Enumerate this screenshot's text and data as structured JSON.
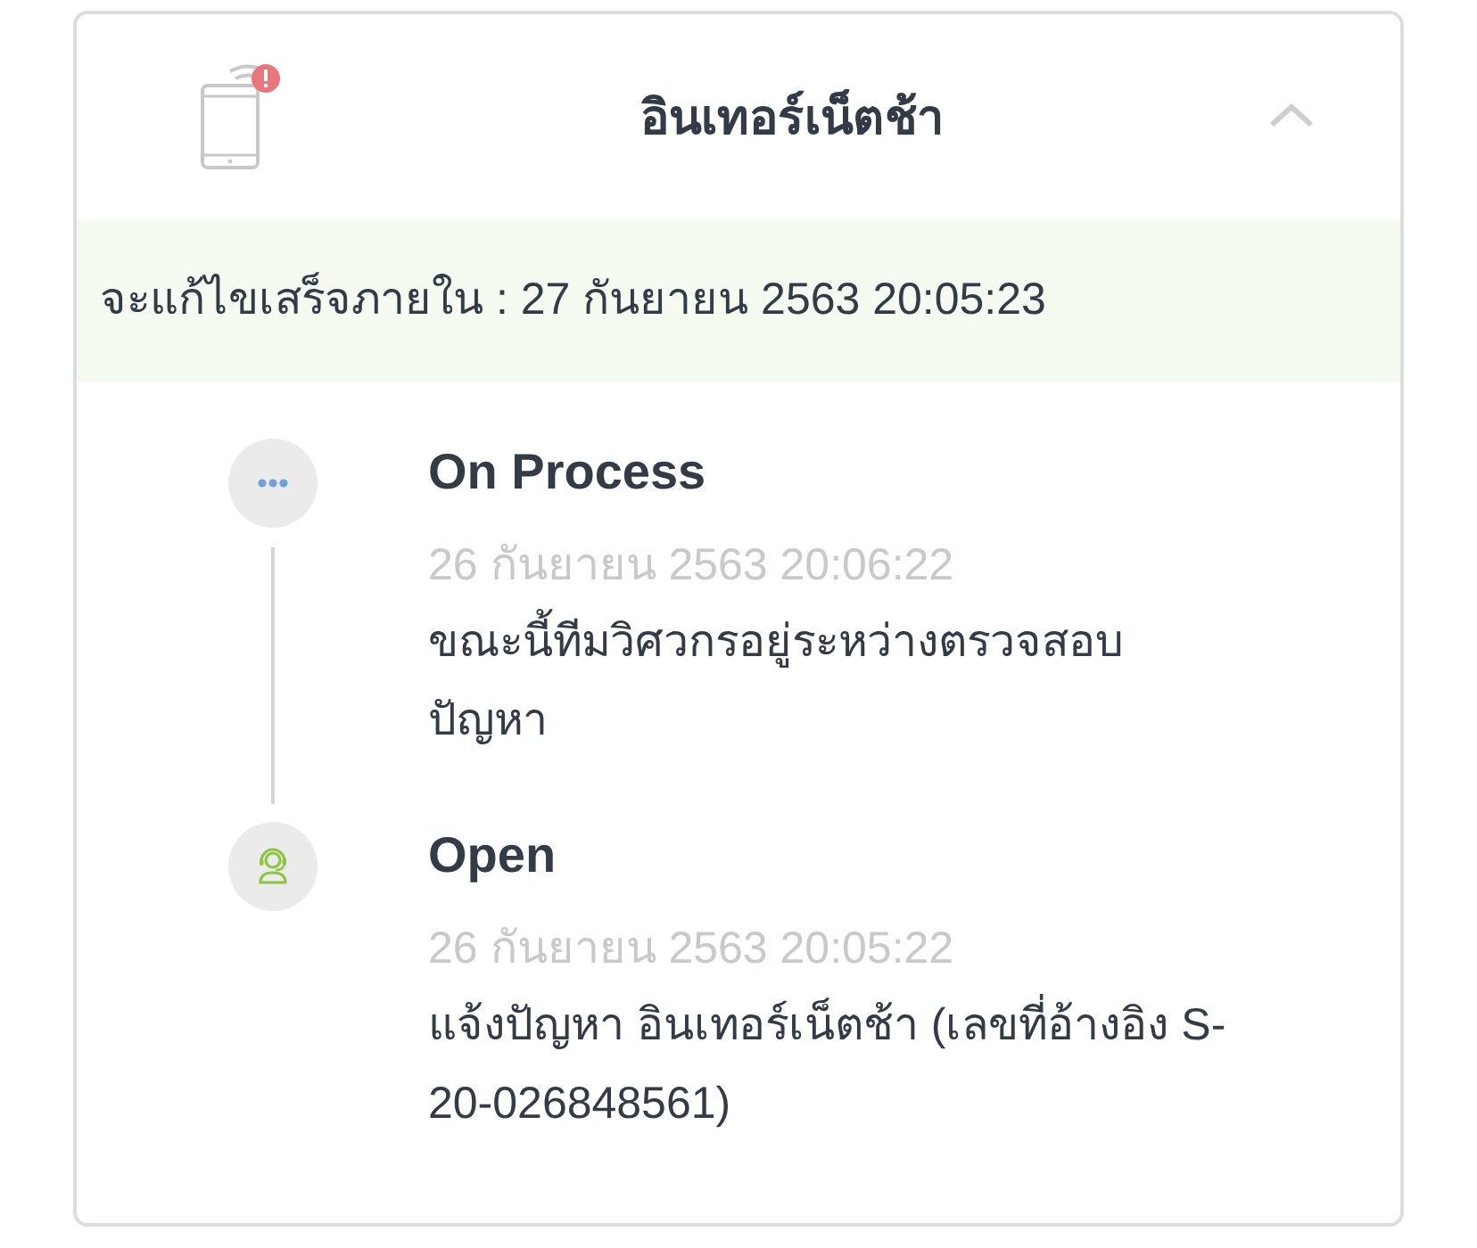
{
  "header": {
    "title": "อินเทอร์เน็ตช้า",
    "expanded": true
  },
  "due_banner": {
    "text": "จะแก้ไขเสร็จภายใน : 27 กันยายน 2563 20:05:23"
  },
  "timeline": [
    {
      "kind": "process",
      "title": "On Process",
      "time": "26 กันยายน 2563 20:06:22",
      "description": "ขณะนี้ทีมวิศวกรอยู่ระหว่างตรวจสอบปัญหา"
    },
    {
      "kind": "open",
      "title": "Open",
      "time": "26 กันยายน 2563 20:05:22",
      "description": "แจ้งปัญหา อินเทอร์เน็ตช้า (เลขที่อ้างอิง S-20-026848561)"
    }
  ]
}
